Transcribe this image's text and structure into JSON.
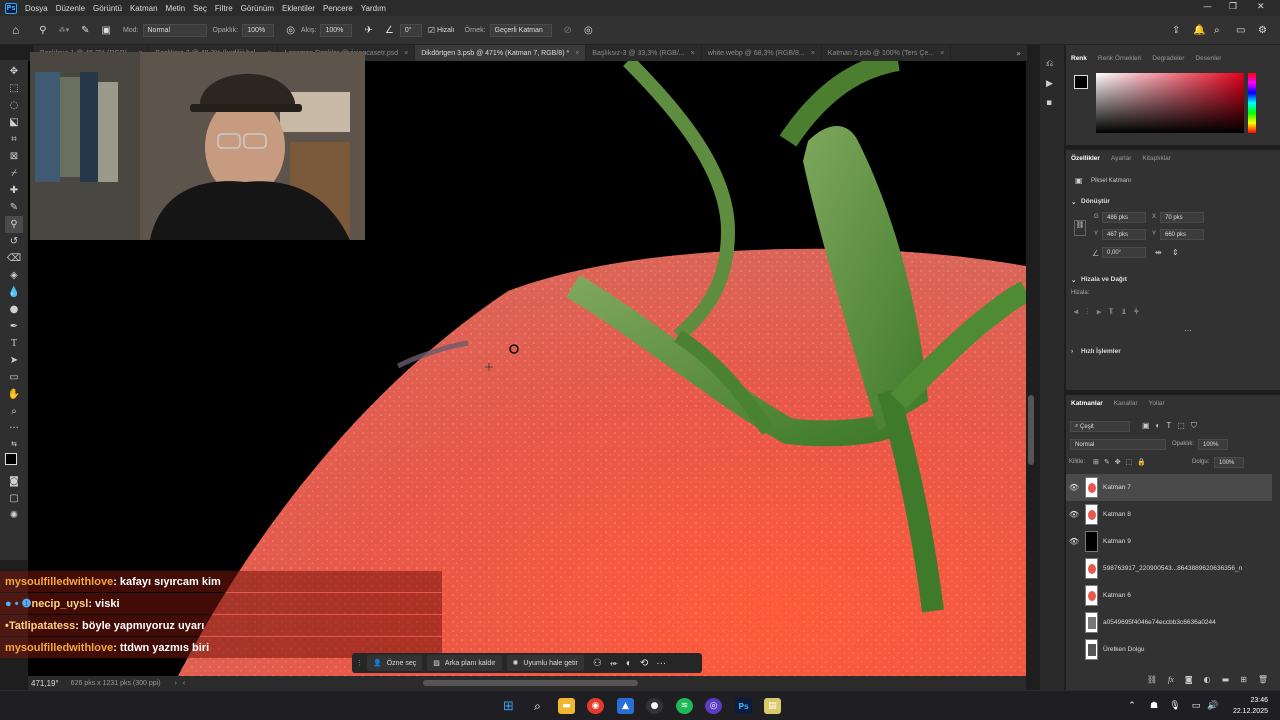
{
  "menubar": {
    "logo": "Ps",
    "items": [
      "Dosya",
      "Düzenle",
      "Görüntü",
      "Katman",
      "Metin",
      "Seç",
      "Filtre",
      "Görünüm",
      "Eklentiler",
      "Pencere",
      "Yardım"
    ]
  },
  "options": {
    "mode_label": "Mod:",
    "mode_value": "Normal",
    "opacity_label": "Opaklık:",
    "opacity_value": "100%",
    "flow_label": "Akış:",
    "flow_value": "100%",
    "angle_value": "0°",
    "align_label": "Hizalı",
    "sample_label": "Örnek:",
    "sample_value": "Geçerli Katman"
  },
  "tabs": [
    {
      "label": "Başlıksız-1 @ 46,2% (RGB/..."
    },
    {
      "label": "Başlıksız-2 @ 48,3% (kırdiliii bal..."
    },
    {
      "label": "Lansman Renkler @visioncasetr.psd"
    },
    {
      "label": "Dikdörtgen 3.psb @ 471% (Katman 7, RGB/8) *"
    },
    {
      "label": "Başlıksız-3 @ 33,3% (RGB/..."
    },
    {
      "label": "white.webp @ 68,3% (RGB/8..."
    },
    {
      "label": "Katman 2.psb @ 100% (Ters Çe..."
    }
  ],
  "chat": [
    {
      "prefix": "",
      "user": "mysoulfilledwithlove",
      "msg": " : kafayı sıyırcam kim"
    },
    {
      "prefix": "● • ❶ ",
      "user": "necip_uysl",
      "msg": " : viski"
    },
    {
      "prefix": "• ",
      "user": "Tatlipatatess",
      "msg": " : böyle yapmıyoruz uyarı"
    },
    {
      "prefix": "",
      "user": "mysoulfilledwithlove",
      "msg": " : ttdwn yazmıs biri"
    }
  ],
  "contextbar": {
    "select_subject": "Özne seç",
    "remove_bg": "Arka planı kaldır",
    "harmonize": "Uyumlu hale getir"
  },
  "status": {
    "zoom": "471,19°",
    "doc_size": "626 pks x 1231 pks (300 ppi)"
  },
  "color_panel": {
    "tabs": [
      "Renk",
      "Renk Örnekleri",
      "Degradeler",
      "Desenler"
    ]
  },
  "properties": {
    "tabs": [
      "Özellikler",
      "Ayarlar",
      "Kitaplıklar"
    ],
    "kind": "Piksel Katmanı",
    "transform_title": "Dönüştür",
    "w_label": "G",
    "w_value": "486 pks",
    "x_label": "X",
    "x_value": "70 pks",
    "h_label": "Y",
    "h_value": "467 pks",
    "y_label": "Y",
    "y_value": "660 pks",
    "angle_value": "0,00°",
    "align_title": "Hizala ve Dağıt",
    "align_sub": "Hizala:",
    "quick_title": "Hızlı İşlemler"
  },
  "layers_panel": {
    "tabs": [
      "Katmanlar",
      "Kanallar",
      "Yollar"
    ],
    "filter": "Çeşit",
    "blend": "Normal",
    "opacity_label": "Opaklık:",
    "opacity_value": "100%",
    "lock_label": "Kilitle:",
    "fill_label": "Dolgu:",
    "fill_value": "100%",
    "layers": [
      {
        "name": "Katman 7"
      },
      {
        "name": "Katman 8"
      },
      {
        "name": "Katman 9"
      },
      {
        "name": "598763917_220900543...8643889620636356_n"
      },
      {
        "name": "Katman 6"
      },
      {
        "name": "a0549695f4046e74eccbb3c6636a0244"
      },
      {
        "name": "Üretken Dolgu"
      }
    ]
  },
  "taskbar": {
    "time": "23:46",
    "date": "22.12.2025"
  },
  "colors": {
    "tomato": "#e8584a",
    "stem": "#4f8a35",
    "accent": "#31a8ff"
  }
}
